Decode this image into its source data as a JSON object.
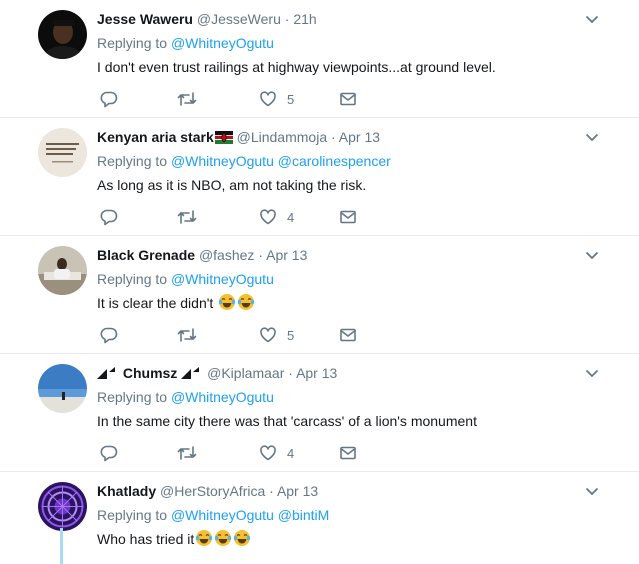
{
  "tweets": [
    {
      "name": "Jesse Waweru",
      "handle": "@JesseWeru",
      "time": "21h",
      "replying_label": "Replying to",
      "mentions": [
        "@WhitneyOgutu"
      ],
      "text": "I don't even trust railings at highway viewpoints...at ground level.",
      "likes": "5",
      "avatar": "dark-portrait"
    },
    {
      "name": "Kenyan aria stark",
      "name_flag": "kenya-flag-emoji",
      "handle": "@Lindammoja",
      "time": "Apr 13",
      "replying_label": "Replying to",
      "mentions": [
        "@WhitneyOgutu",
        "@carolinespencer"
      ],
      "text": "As long as it is NBO, am not taking the risk.",
      "likes": "4",
      "avatar": "quote-card"
    },
    {
      "name": "Black Grenade",
      "handle": "@fashez",
      "time": "Apr 13",
      "replying_label": "Replying to",
      "mentions": [
        "@WhitneyOgutu"
      ],
      "text": "It is clear the didn't",
      "text_emojis": 2,
      "likes": "5",
      "avatar": "office-desk"
    },
    {
      "name": "Chumsz",
      "name_decor": "arrow-logo",
      "handle": "@Kiplamaar",
      "time": "Apr 13",
      "replying_label": "Replying to",
      "mentions": [
        "@WhitneyOgutu"
      ],
      "text": "In the same city there was that 'carcass' of a lion's monument",
      "likes": "4",
      "avatar": "beach"
    },
    {
      "name": "Khatlady",
      "handle": "@HerStoryAfrica",
      "time": "Apr 13",
      "replying_label": "Replying to",
      "mentions": [
        "@WhitneyOgutu",
        "@bintiM"
      ],
      "text": "Who has tried it",
      "text_emojis": 3,
      "avatar": "purple-mandala"
    }
  ],
  "separator": "·",
  "colors": {
    "link": "#1da1f2",
    "muted": "#657786",
    "divider": "#e6ecf0",
    "thread": "#a9d9f4"
  }
}
